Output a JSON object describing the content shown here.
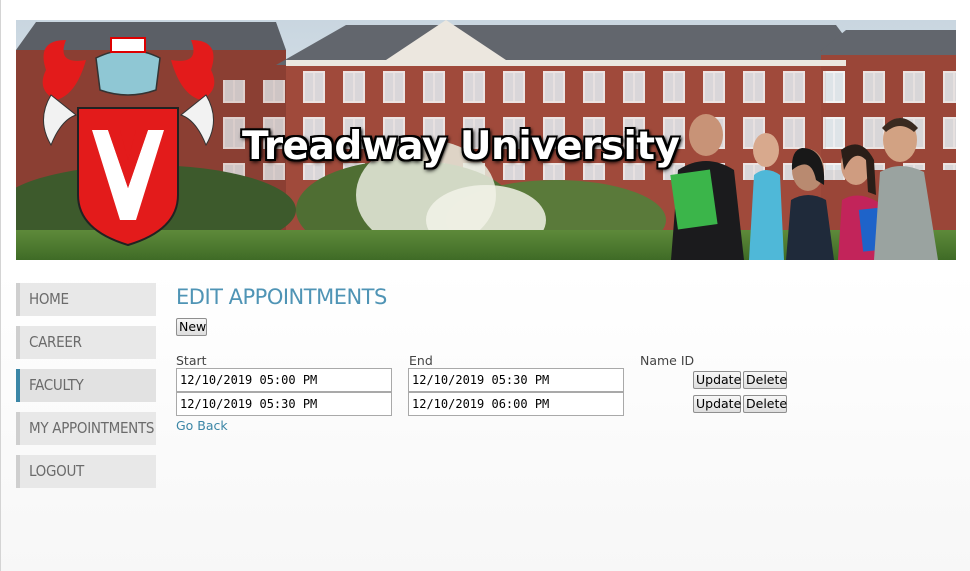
{
  "banner": {
    "title": "Treadway University"
  },
  "nav": {
    "items": [
      {
        "label": "HOME"
      },
      {
        "label": "CAREER"
      },
      {
        "label": "FACULTY"
      },
      {
        "label": "MY APPOINTMENTS"
      },
      {
        "label": "LOGOUT"
      }
    ],
    "active": "FACULTY"
  },
  "main": {
    "title": "EDIT APPOINTMENTS",
    "new_label": "New",
    "columns": {
      "start": "Start",
      "end": "End",
      "name_id": "Name ID"
    },
    "rows": [
      {
        "start": "12/10/2019 05:00 PM",
        "end": "12/10/2019 05:30 PM",
        "update": "Update",
        "delete": "Delete"
      },
      {
        "start": "12/10/2019 05:30 PM",
        "end": "12/10/2019 06:00 PM",
        "update": "Update",
        "delete": "Delete"
      }
    ],
    "go_back": "Go Back"
  },
  "colors": {
    "accent": "#4f94b5",
    "link": "#3b86a6",
    "nav_bg": "#e8e8e8"
  }
}
